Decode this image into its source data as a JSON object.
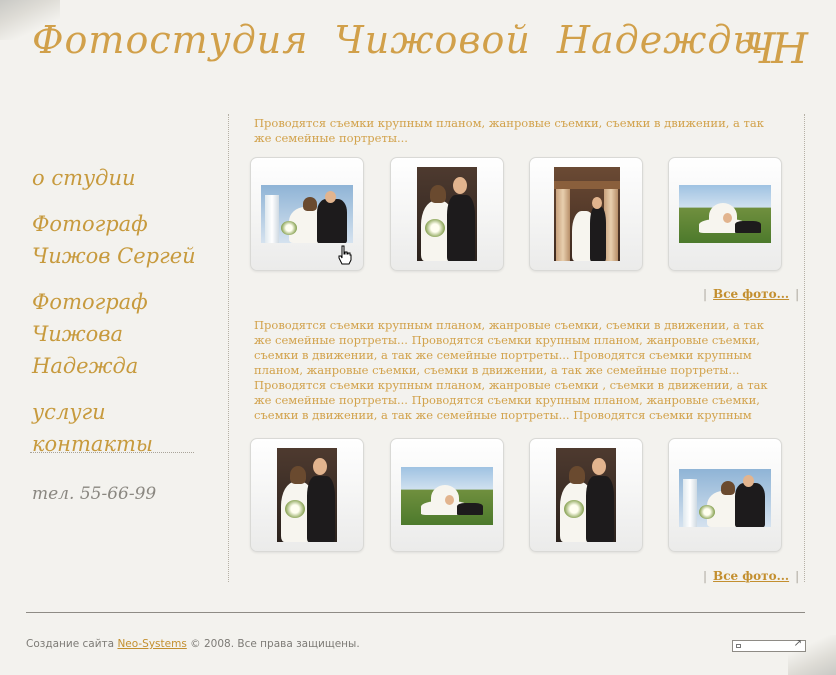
{
  "header": {
    "title_words": [
      "Фотостудия",
      "Чижовой",
      "Надежды"
    ],
    "monogram": "ЧН"
  },
  "nav": {
    "about": "о студии",
    "photographer1_line1": "Фотограф",
    "photographer1_line2": "Чижов Сергей",
    "photographer2_line1": "Фотограф",
    "photographer2_line2": "Чижова Надежда",
    "services": "услуги",
    "contacts": "контакты"
  },
  "phone": "тел. 55-66-99",
  "gallery": {
    "intro1": "Проводятся съемки крупным планом, жанровые съемки, съемки в движении, а так же семейные портреты...",
    "intro2": "Проводятся съемки крупным планом, жанровые съемки, съемки в движении, а так же семейные портреты... Проводятся съемки крупным планом, жанровые съемки, съемки в движении, а так же семейные портреты... Проводятся съемки крупным планом, жанровые съемки, съемки в движении, а так же семейные портреты... Проводятся съемки крупным планом, жанровые съемки , съемки в движении, а так же семейные портреты... Проводятся съемки крупным планом, жанровые съемки, съемки в движении, а так же семейные портреты... Проводятся съемки крупным планом, жанровые съемки, съемки в движении, а так же семейные портреты...",
    "all_photos_label": "Все фото...",
    "sep": "|"
  },
  "footer": {
    "prefix": "Создание сайта",
    "link": "Neo-Systems",
    "suffix": "© 2008. Все права защищены."
  },
  "colors": {
    "accent": "#d1a04a",
    "link": "#c38f2f",
    "background": "#f3f2ee"
  }
}
